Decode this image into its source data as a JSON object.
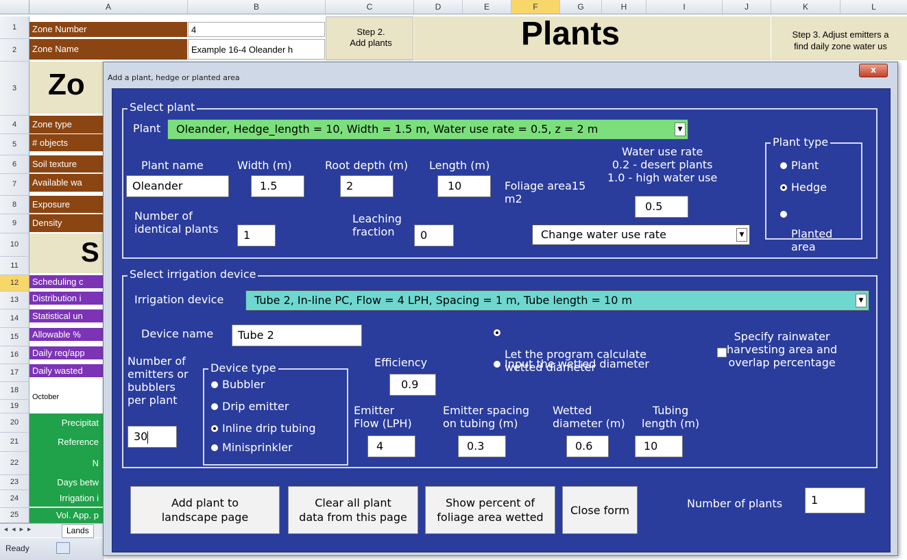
{
  "sheet": {
    "columns": [
      "A",
      "B",
      "C",
      "D",
      "E",
      "F",
      "G",
      "H",
      "I",
      "J",
      "K",
      "L"
    ],
    "rows": [
      "1",
      "2",
      "3",
      "4",
      "5",
      "6",
      "7",
      "8",
      "9",
      "10",
      "11",
      "12",
      "13",
      "14",
      "15",
      "16",
      "17",
      "18",
      "19",
      "20",
      "21",
      "22",
      "23",
      "24",
      "25"
    ],
    "zone_number_label": "Zone Number",
    "zone_number_value": "4",
    "zone_name_label": "Zone Name",
    "zone_name_value": "Example 16-4 Oleander h",
    "step2": "Step 2.\nAdd plants",
    "plants_title": "Plants",
    "step3": "Step 3. Adjust emitters a\nfind daily zone water us",
    "zone_title_fragment": "Zo",
    "s_fragment": "S",
    "zone_type": "Zone type",
    "num_objects": "# objects",
    "soil_texture": "Soil texture",
    "available_water": "Available wa",
    "exposure": "Exposure",
    "density": "Density",
    "scheduling": "Scheduling c",
    "distribution": "Distribution i",
    "statistical": "Statistical un",
    "allowable": "Allowable %",
    "daily_req": "Daily req/app",
    "daily_wasted": "Daily wasted",
    "month": "October",
    "precip": "Precipitat",
    "reference": "Reference",
    "n_fragment": "N",
    "days_between": "Days betw",
    "irrigation": "Irrigation i",
    "vol_app": "Vol. App. p",
    "sheet_tab": "Lands",
    "status": "Ready"
  },
  "dialog": {
    "title": "Add a plant, hedge or planted area",
    "close_label": "x",
    "select_plant": {
      "legend": "Select plant",
      "plant_label": "Plant",
      "plant_combo": "Oleander, Hedge_length = 10, Width = 1.5 m, Water use rate = 0.5, z = 2 m",
      "plant_name_label": "Plant name",
      "plant_name_value": "Oleander",
      "width_label": "Width (m)",
      "width_value": "1.5",
      "root_depth_label": "Root depth (m)",
      "root_depth_value": "2",
      "length_label": "Length (m)",
      "length_value": "10",
      "foliage_area_label": "Foliage area15\nm2",
      "water_use_label": "Water use rate\n0.2 - desert plants\n1.0 - high water use",
      "water_use_value": "0.5",
      "num_identical_label": "Number of\nidentical plants",
      "num_identical_value": "1",
      "leaching_label": "Leaching\nfraction",
      "leaching_value": "0",
      "change_water_use_combo": "Change water use rate",
      "plant_type": {
        "legend": "Plant type",
        "options": [
          "Plant",
          "Hedge",
          "Planted\narea"
        ],
        "selected": "Hedge"
      }
    },
    "select_device": {
      "legend": "Select irrigation device",
      "device_label": "Irrigation device",
      "device_combo": "Tube 2, In-line PC, Flow = 4 LPH, Spacing = 1 m, Tube length = 10 m",
      "device_name_label": "Device name",
      "device_name_value": "Tube 2",
      "calc_wetted": "Let the program calculate\nwetted diameter",
      "input_wetted": "Input the wetted diameter",
      "rainwater": "Specify rainwater\nharvesting area and\noverlap percentage",
      "num_emitters_label": "Number of\nemitters or\nbubblers\nper plant",
      "num_emitters_value": "30",
      "device_type": {
        "legend": "Device type",
        "options": [
          "Bubbler",
          "Drip emitter",
          "Inline drip tubing",
          "Minisprinkler"
        ],
        "selected": "Inline drip tubing"
      },
      "efficiency_label": "Efficiency",
      "efficiency_value": "0.9",
      "emitter_flow_label": "Emitter\nFlow (LPH)",
      "emitter_flow_value": "4",
      "emitter_spacing_label": "Emitter spacing\non tubing (m)",
      "emitter_spacing_value": "0.3",
      "wetted_diameter_label": "Wetted\ndiameter (m)",
      "wetted_diameter_value": "0.6",
      "tubing_length_label": "Tubing\nlength (m)",
      "tubing_length_value": "10"
    },
    "buttons": {
      "add_plant": "Add plant to\nlandscape page",
      "clear_all": "Clear all plant\ndata from this page",
      "show_percent": "Show percent of\nfoliage area wetted",
      "close_form": "Close form"
    },
    "num_plants_label": "Number of plants",
    "num_plants_value": "1"
  },
  "colors": {
    "dialog_blue": "#2a3c9c",
    "plant_combo_green": "#7be07b",
    "device_combo_teal": "#6ed8d0",
    "sheet_brown": "#8b4513",
    "sheet_purple": "#7c33b6",
    "sheet_green": "#1fa24a"
  }
}
